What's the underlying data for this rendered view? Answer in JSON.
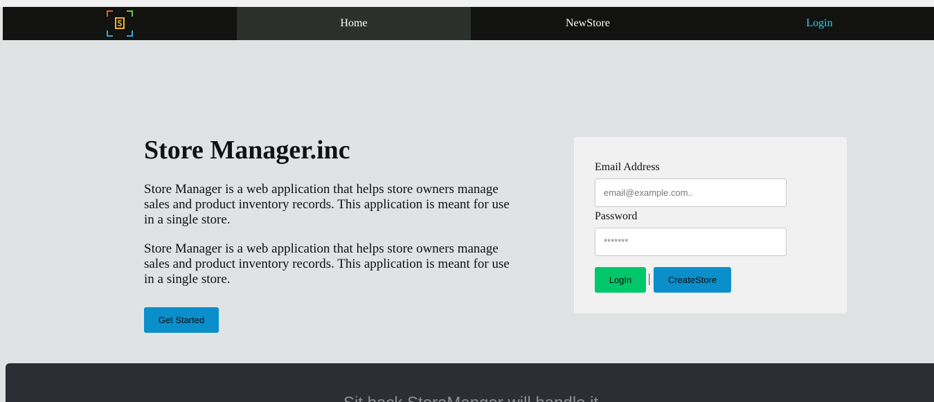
{
  "nav": {
    "logo_letter": "S",
    "items": [
      {
        "label": "Home"
      },
      {
        "label": "NewStore"
      },
      {
        "label": "Login"
      }
    ]
  },
  "hero": {
    "title": "Store Manager.inc",
    "paragraph1": "Store Manager is a web application that helps store owners manage sales and product inventory records. This application is meant for use in a single store.",
    "paragraph2": "Store Manager is a web application that helps store owners manage sales and product inventory records. This application is meant for use in a single store.",
    "cta_label": "Get Started"
  },
  "login_form": {
    "email_label": "Email Address",
    "email_placeholder": "email@example.com..",
    "password_label": "Password",
    "password_placeholder": "*******",
    "login_label": "LogIn",
    "separator": "|",
    "create_label": "CreateStore"
  },
  "footer": {
    "tagline": "Sit back StoreManger will handle it"
  },
  "colors": {
    "nav_bg": "#121210",
    "nav_active": "#2c302b",
    "login_link": "#2fd0e6",
    "primary_blue": "#0a8fcb",
    "green": "#00c86a",
    "page_bg": "#dfe3e3",
    "footer_bg": "#2d2e33"
  }
}
